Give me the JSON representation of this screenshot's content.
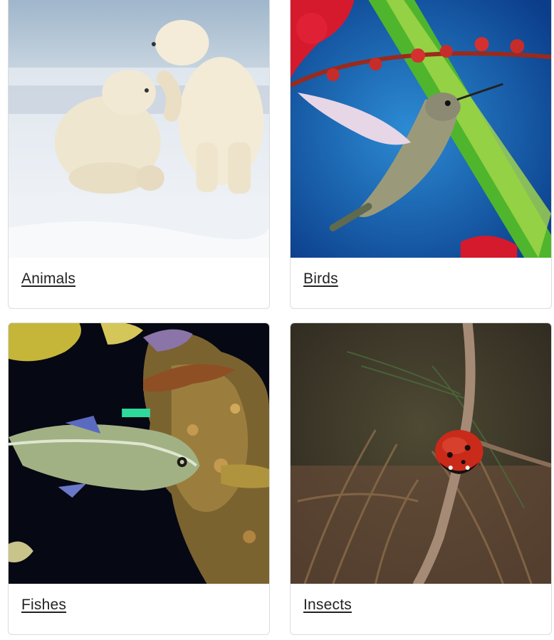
{
  "cards": [
    {
      "title": "Animals",
      "image": "polar-bears-image"
    },
    {
      "title": "Birds",
      "image": "hummingbird-image"
    },
    {
      "title": "Fishes",
      "image": "fishes-image"
    },
    {
      "title": "Insects",
      "image": "ladybug-image"
    }
  ],
  "colors": {
    "card_border": "#dcdcdc",
    "title_text": "#222222"
  }
}
